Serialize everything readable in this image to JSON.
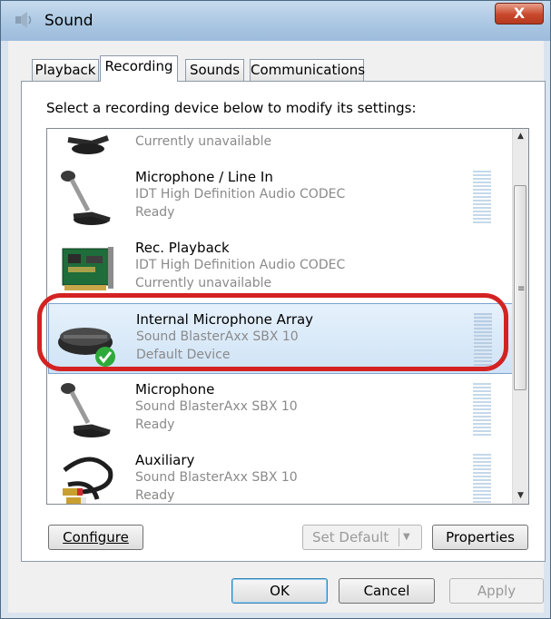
{
  "window": {
    "title": "Sound",
    "close_glyph": "X"
  },
  "tabs": [
    {
      "label": "Playback",
      "active": false
    },
    {
      "label": "Recording",
      "active": true
    },
    {
      "label": "Sounds",
      "active": false
    },
    {
      "label": "Communications",
      "active": false
    }
  ],
  "instruction": "Select a recording device below to modify its settings:",
  "devices": [
    {
      "name": "",
      "driver": "",
      "status": "Currently unavailable",
      "icon": "microphone-icon"
    },
    {
      "name": "Microphone / Line In",
      "driver": "IDT High Definition Audio CODEC",
      "status": "Ready",
      "icon": "microphone-icon"
    },
    {
      "name": "Rec. Playback",
      "driver": "IDT High Definition Audio CODEC",
      "status": "Currently unavailable",
      "icon": "sound-card-icon"
    },
    {
      "name": "Internal Microphone Array",
      "driver": "Sound BlasterAxx SBX 10",
      "status": "Default Device",
      "icon": "microphone-array-icon",
      "selected": true
    },
    {
      "name": "Microphone",
      "driver": "Sound BlasterAxx SBX 10",
      "status": "Ready",
      "icon": "microphone-icon"
    },
    {
      "name": "Auxiliary",
      "driver": "Sound BlasterAxx SBX 10",
      "status": "Ready",
      "icon": "rca-cable-icon"
    }
  ],
  "buttons": {
    "configure": "Configure",
    "set_default": "Set Default",
    "properties": "Properties",
    "ok": "OK",
    "cancel": "Cancel",
    "apply": "Apply"
  },
  "colors": {
    "highlight": "#d42222",
    "selected_bg": "#cfe3f6",
    "default_check": "#2eaa3a"
  }
}
